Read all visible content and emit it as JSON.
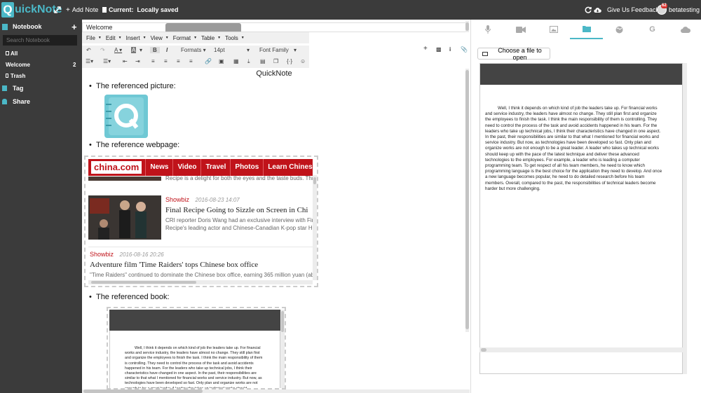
{
  "app": {
    "brand_q": "Q",
    "brand_rest": "uickNote"
  },
  "top": {
    "add_note": "Add Note",
    "current_label": "Current:",
    "current_value": "Locally saved",
    "feedback": "Give Us Feedback",
    "user": "betatesting",
    "notif_count": "62"
  },
  "sidebar": {
    "notebook": "Notebook",
    "search_placeholder": "Search Notebook",
    "items": [
      {
        "label": "All",
        "count": ""
      },
      {
        "label": "Welcome",
        "count": "2"
      },
      {
        "label": "Trash",
        "count": ""
      }
    ],
    "tag": "Tag",
    "share": "Share"
  },
  "editor": {
    "title": "Welcome",
    "menus": [
      "File",
      "Edit",
      "Insert",
      "View",
      "Format",
      "Table",
      "Tools"
    ],
    "formats": "Formats",
    "font_size": "14pt",
    "font_family": "Font Family",
    "doc_heading": "QuickNote",
    "pic_label": "The referenced picture:",
    "web_label": "The reference webpage:",
    "book_label": "The referenced book:"
  },
  "webpage": {
    "logo": "china.com",
    "nav": [
      "News",
      "Video",
      "Travel",
      "Photos",
      "Learn Chinese"
    ],
    "top_snippet": "Recipe is a delight for both the eyes and the taste buds. Thre",
    "articles": [
      {
        "category": "Showbiz",
        "date": "2016-08-23 14:07",
        "title": "Final Recipe Going to Sizzle on Screen in Chi",
        "summary1": "CRI reporter Doris Wang had an exclusive interview with Fina",
        "summary2": "Recipe's leading actor and Chinese-Canadian K-pop star He"
      },
      {
        "category": "Showbiz",
        "date": "2016-08-16 20:26",
        "title": "Adventure film 'Time Raiders' tops Chinese box office",
        "summary1": "\"Time Raiders\" continued to dominate the Chinese box office, earning 365 million yuan (abo"
      }
    ]
  },
  "book": {
    "text": "Well, I think it depends on which kind of job the leaders take up. For financial works and service industry, the leaders have almost no change. They still plan first and organize the employees to finish the task. I think the main responsibility of them is controlling. They need to control the process of the task and avoid accidents happened in his team. For the leaders who take up technical jobs, I think their characteristics have changed in one aspect. In the past, their responsibilities are similar to that what I mentioned for financial works and service industry. But now, as technologies have been developed so fast. Only plan and organize works are not enough to be a great leader.  A leader who takes up technical works should"
  },
  "right": {
    "choose_file": "Choose a file to open",
    "doc_text": "Well, I think it depends on which kind of job the leaders take up. For financial works and service industry, the leaders have almost no change. They still plan first and organize the employees to finish the task. I think the main responsibility of them is controlling. They need to control the process of the task and avoid accidents happened in his team. For the leaders who take up technical jobs, I think their characteristics have changed in one aspect. In the past, their responsibilities are similar to that what I mentioned for financial works and service industry. But now, as technologies have been developed so fast. Only plan and organize works are not enough to be a great leader.  A leader who takes up technical works should keep up with the pace of the latest technique and deliver these advanced technologies to the employees. For example, a leader who is leading a computer programming team. To get respect of all his team members, he need to know which programming language is the best choice for the application they need to develop. And once a new language becomes popular, he need to do detailed research before his team members. Overall, compared to the past, the responsibilities of technical leaders become harder but more challenging."
  },
  "colors": {
    "accent": "#4bb8c7",
    "dark": "#3b3b3b",
    "china_red": "#c0131a"
  }
}
